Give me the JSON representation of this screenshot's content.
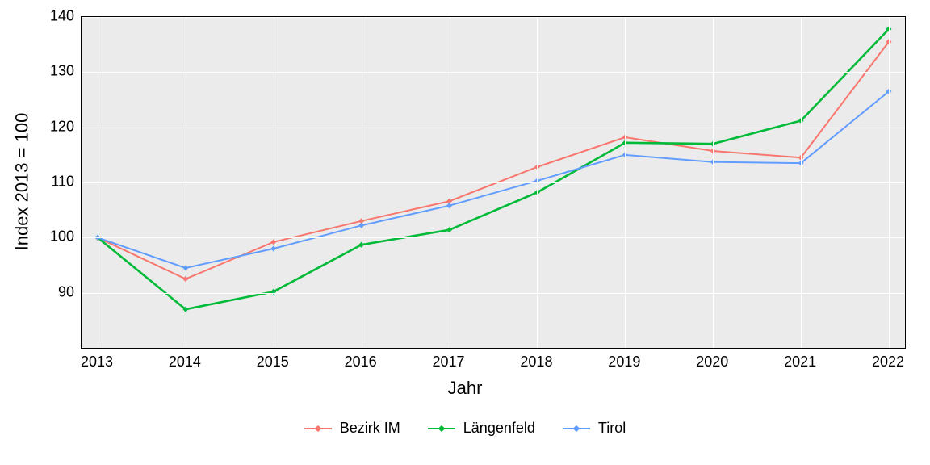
{
  "chart_data": {
    "type": "line",
    "xlabel": "Jahr",
    "ylabel": "Index  2013  = 100",
    "ylim": [
      80,
      140
    ],
    "y_ticks": [
      90,
      100,
      110,
      120,
      130,
      140
    ],
    "categories": [
      "2013",
      "2014",
      "2015",
      "2016",
      "2017",
      "2018",
      "2019",
      "2020",
      "2021",
      "2022"
    ],
    "series": [
      {
        "name": "Bezirk IM",
        "color": "#f8766d",
        "values": [
          100,
          92.5,
          99.2,
          103.0,
          106.6,
          112.8,
          118.2,
          115.7,
          114.5,
          135.5
        ]
      },
      {
        "name": "Längenfeld",
        "color": "#00ba38",
        "values": [
          100,
          87.0,
          90.2,
          98.7,
          101.4,
          108.2,
          117.2,
          117.0,
          121.2,
          137.8
        ]
      },
      {
        "name": "Tirol",
        "color": "#619cff",
        "values": [
          100,
          94.5,
          98.0,
          102.2,
          105.8,
          110.3,
          115.0,
          113.7,
          113.5,
          126.5
        ]
      }
    ],
    "legend_position": "bottom"
  }
}
